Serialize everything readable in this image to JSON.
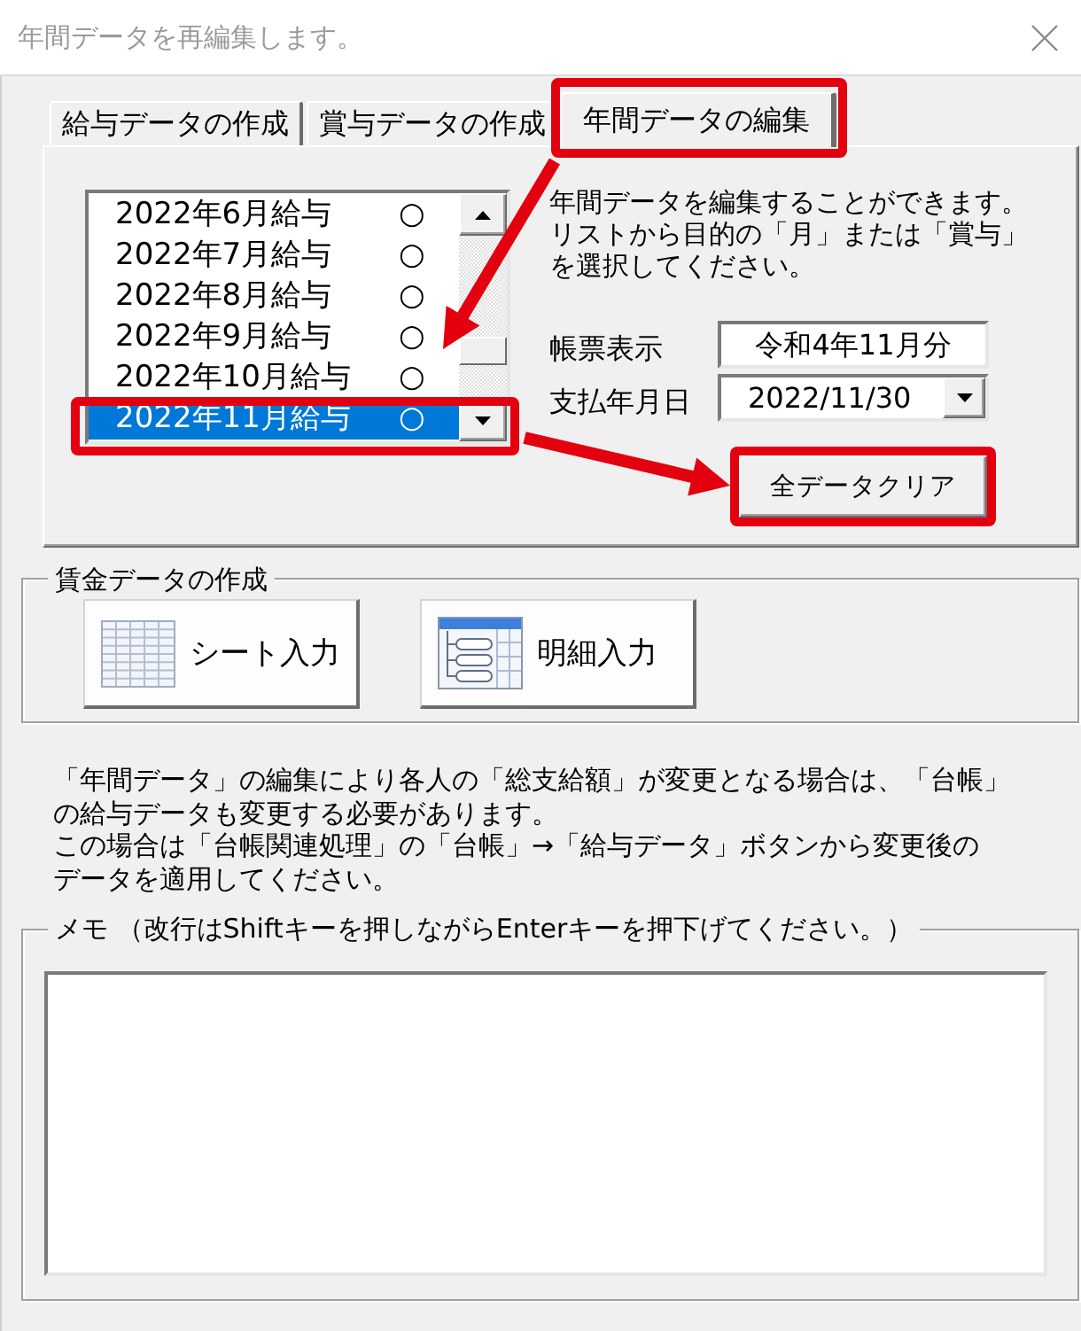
{
  "window": {
    "title": "年間データを再編集します。"
  },
  "tabs": [
    {
      "label": "給与データの作成",
      "selected": false,
      "highlighted": false
    },
    {
      "label": "賞与データの作成",
      "selected": false,
      "highlighted": false
    },
    {
      "label": "年間データの編集",
      "selected": true,
      "highlighted": true
    }
  ],
  "month_list": {
    "items": [
      {
        "label": "2022年6月給与",
        "status": "○",
        "selected": false,
        "highlighted": false
      },
      {
        "label": "2022年7月給与",
        "status": "○",
        "selected": false,
        "highlighted": false
      },
      {
        "label": "2022年8月給与",
        "status": "○",
        "selected": false,
        "highlighted": false
      },
      {
        "label": "2022年9月給与",
        "status": "○",
        "selected": false,
        "highlighted": false
      },
      {
        "label": "2022年10月給与",
        "status": "○",
        "selected": false,
        "highlighted": false
      },
      {
        "label": "2022年11月給与",
        "status": "○",
        "selected": true,
        "highlighted": true
      }
    ]
  },
  "description": "年間データを編集することができます。リストから目的の「月」または「賞与」を選択してください。",
  "fields": [
    {
      "label": "帳票表示",
      "value": "令和4年11月分",
      "kind": "text"
    },
    {
      "label": "支払年月日",
      "value": "2022/11/30",
      "kind": "dropdown"
    }
  ],
  "clear_button": {
    "label": "全データクリア",
    "highlighted": true
  },
  "wage_group": {
    "title": "賃金データの作成",
    "buttons": [
      {
        "label": "シート入力",
        "kind": "sheet"
      },
      {
        "label": "明細入力",
        "kind": "detail"
      }
    ]
  },
  "notice": {
    "paragraphs": [
      "「年間データ」の編集により各人の「総支給額」が変更となる場合は、「台帳」の給与データも変更する必要があります。",
      "この場合は「台帳関連処理」の「台帳」→「給与データ」ボタンから変更後のデータを適用してください。"
    ]
  },
  "memo": {
    "title": "メモ （改行はShiftキーを押しながらEnterキーを押下げてください。）"
  },
  "callout_arrows": true
}
